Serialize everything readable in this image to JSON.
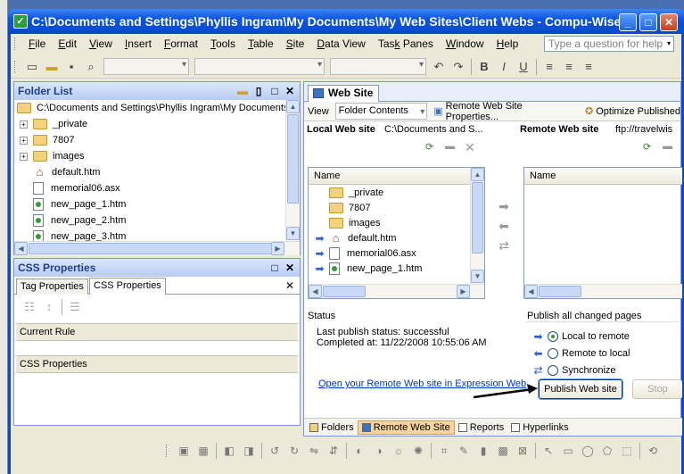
{
  "window": {
    "title": "C:\\Documents and Settings\\Phyllis  Ingram\\My Documents\\My Web Sites\\Client Webs - Compu-Wise\\trav...",
    "minimize": "_",
    "maximize": "□",
    "close": "✕"
  },
  "menu": {
    "items": [
      {
        "u": "F",
        "rest": "ile"
      },
      {
        "u": "E",
        "rest": "dit"
      },
      {
        "u": "V",
        "rest": "iew"
      },
      {
        "u": "I",
        "rest": "nsert"
      },
      {
        "u": "F",
        "rest": "ormat",
        "pre": ""
      },
      {
        "u": "T",
        "rest": "ools"
      },
      {
        "u": "T",
        "rest": "able",
        "pre": ""
      },
      {
        "u": "S",
        "rest": "ite"
      },
      {
        "u": "D",
        "rest": "ata View"
      },
      {
        "pre": "Tas",
        "u": "k",
        "rest": " Panes"
      },
      {
        "u": "W",
        "rest": "indow"
      },
      {
        "u": "H",
        "rest": "elp"
      }
    ],
    "help_placeholder": "Type a question for help"
  },
  "folder_list": {
    "title": "Folder List",
    "root": "C:\\Documents and Settings\\Phyllis  Ingram\\My Documents",
    "items": [
      {
        "label": "_private",
        "kind": "folder",
        "expand": true
      },
      {
        "label": "7807",
        "kind": "folder",
        "expand": true
      },
      {
        "label": "images",
        "kind": "folder",
        "expand": true
      },
      {
        "label": "default.htm",
        "kind": "home"
      },
      {
        "label": "memorial06.asx",
        "kind": "file"
      },
      {
        "label": "new_page_1.htm",
        "kind": "htm"
      },
      {
        "label": "new_page_2.htm",
        "kind": "htm"
      },
      {
        "label": "new_page_3.htm",
        "kind": "htm"
      }
    ]
  },
  "css_panel": {
    "title": "CSS Properties",
    "tab_tag": "Tag Properties",
    "tab_css": "CSS Properties",
    "current_rule": "Current Rule",
    "css_properties": "CSS Properties"
  },
  "website": {
    "tab_label": "Web Site",
    "view_label": "View",
    "view_value": "Folder Contents",
    "remote_props": "Remote Web Site Properties...",
    "optimize": "Optimize Published",
    "local_label": "Local Web site",
    "local_path": "C:\\Documents and S...",
    "remote_label": "Remote Web site",
    "remote_path": "ftp://travelwis",
    "name_header": "Name",
    "local_items": [
      {
        "label": "_private",
        "kind": "folder",
        "arrow": false
      },
      {
        "label": "7807",
        "kind": "folder",
        "arrow": false
      },
      {
        "label": "images",
        "kind": "folder",
        "arrow": false
      },
      {
        "label": "default.htm",
        "kind": "home",
        "arrow": true
      },
      {
        "label": "memorial06.asx",
        "kind": "file",
        "arrow": true
      },
      {
        "label": "new_page_1.htm",
        "kind": "htm",
        "arrow": true
      }
    ],
    "status_label": "Status",
    "status_line1": "Last publish status: successful",
    "status_line2": "Completed at: 11/22/2008 10:55:06 AM",
    "open_remote_link": "Open your Remote Web site in Expression Web",
    "publish_all_label": "Publish all changed pages",
    "radio_local": "Local to remote",
    "radio_remote": "Remote to local",
    "radio_sync": "Synchronize",
    "publish_button": "Publish Web site",
    "stop_button": "Stop"
  },
  "bottom_tabs": {
    "folders": "Folders",
    "remote": "Remote Web Site",
    "reports": "Reports",
    "hyperlinks": "Hyperlinks"
  },
  "colors": {
    "title_bar": "#0c54e0",
    "panel_header": "#c4d6f7",
    "active_tab": "#f5d49d"
  }
}
